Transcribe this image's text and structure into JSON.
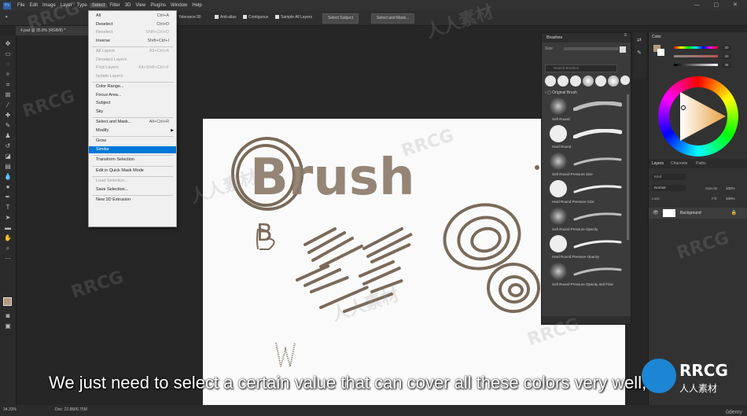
{
  "menubar": {
    "app_icon": "Ps",
    "items": [
      "File",
      "Edit",
      "Image",
      "Layer",
      "Type",
      "Select",
      "Filter",
      "3D",
      "View",
      "Plugins",
      "Window",
      "Help"
    ],
    "active": "Select"
  },
  "options": {
    "tolerance_label": "Tolerance:",
    "tolerance_value": "30",
    "antialias": "Anti-alias",
    "contiguous": "Contiguous",
    "sample_all": "Sample All Layers",
    "select_subject": "Select Subject",
    "select_mask": "Select and Mask..."
  },
  "document": {
    "tab_label": "4.psd @ 35.8% (RGB/8) *"
  },
  "select_menu": [
    {
      "label": "All",
      "shortcut": "Ctrl+A",
      "state": "normal"
    },
    {
      "label": "Deselect",
      "shortcut": "Ctrl+D",
      "state": "normal"
    },
    {
      "label": "Reselect",
      "shortcut": "Shift+Ctrl+D",
      "state": "disabled"
    },
    {
      "label": "Inverse",
      "shortcut": "Shift+Ctrl+I",
      "state": "normal"
    },
    {
      "sep": true
    },
    {
      "label": "All Layers",
      "shortcut": "Alt+Ctrl+A",
      "state": "disabled"
    },
    {
      "label": "Deselect Layers",
      "shortcut": "",
      "state": "disabled"
    },
    {
      "label": "Find Layers",
      "shortcut": "Alt+Shift+Ctrl+F",
      "state": "disabled"
    },
    {
      "label": "Isolate Layers",
      "shortcut": "",
      "state": "disabled"
    },
    {
      "sep": true
    },
    {
      "label": "Color Range...",
      "shortcut": "",
      "state": "normal"
    },
    {
      "label": "Focus Area...",
      "shortcut": "",
      "state": "normal"
    },
    {
      "label": "Subject",
      "shortcut": "",
      "state": "normal"
    },
    {
      "label": "Sky",
      "shortcut": "",
      "state": "normal"
    },
    {
      "sep": true
    },
    {
      "label": "Select and Mask...",
      "shortcut": "Alt+Ctrl+R",
      "state": "normal"
    },
    {
      "label": "Modify",
      "shortcut": "",
      "state": "normal",
      "submenu": true
    },
    {
      "sep": true
    },
    {
      "label": "Grow",
      "shortcut": "",
      "state": "normal"
    },
    {
      "label": "Similar",
      "shortcut": "",
      "state": "highlight"
    },
    {
      "sep": true
    },
    {
      "label": "Transform Selection",
      "shortcut": "",
      "state": "normal"
    },
    {
      "sep": true
    },
    {
      "label": "Edit in Quick Mask Mode",
      "shortcut": "",
      "state": "normal"
    },
    {
      "sep": true
    },
    {
      "label": "Load Selection...",
      "shortcut": "",
      "state": "disabled"
    },
    {
      "label": "Save Selection...",
      "shortcut": "",
      "state": "normal"
    },
    {
      "sep": true
    },
    {
      "label": "New 3D Extrusion",
      "shortcut": "",
      "state": "normal"
    }
  ],
  "brushes": {
    "title": "Brushes",
    "size_label": "Size:",
    "search_placeholder": "Search Brushes",
    "group": "Original Brush",
    "items": [
      "Soft Round",
      "Hard Round",
      "Soft Round Pressure Size",
      "Hard Round Pressure Size",
      "Soft Round Pressure Opacity",
      "Hard Round Pressure Opacity",
      "Soft Round Pressure Opacity and Flow"
    ]
  },
  "color_panel": {
    "title": "Color",
    "values": [
      "30",
      "33",
      "35"
    ]
  },
  "layers_panel": {
    "tabs": [
      "Layers",
      "Channels",
      "Paths"
    ],
    "kind_placeholder": "Kind",
    "blend": "Normal",
    "opacity_label": "Opacity:",
    "opacity": "100%",
    "lock_label": "Lock:",
    "fill_label": "Fill:",
    "fill": "100%",
    "layer_name": "Background"
  },
  "canvas_text": {
    "big_word": "Brush",
    "letter_b": "B",
    "letter_w": "W"
  },
  "status": {
    "zoom": "34.33%",
    "doc": "Doc: 22.8M/6.75M"
  },
  "caption": "We just need to select a certain value that can cover all these colors very well,",
  "watermark": {
    "text": "RRCG",
    "cn": "人人素材"
  },
  "logo": {
    "big": "RRCG",
    "small": "人人素材"
  },
  "udemy": "ûdemy",
  "colors": {
    "ui_bg": "#262626",
    "menu_highlight": "#0078d7",
    "brush_ink": "#7a6a5a",
    "fg_color": "#b59a7e"
  }
}
